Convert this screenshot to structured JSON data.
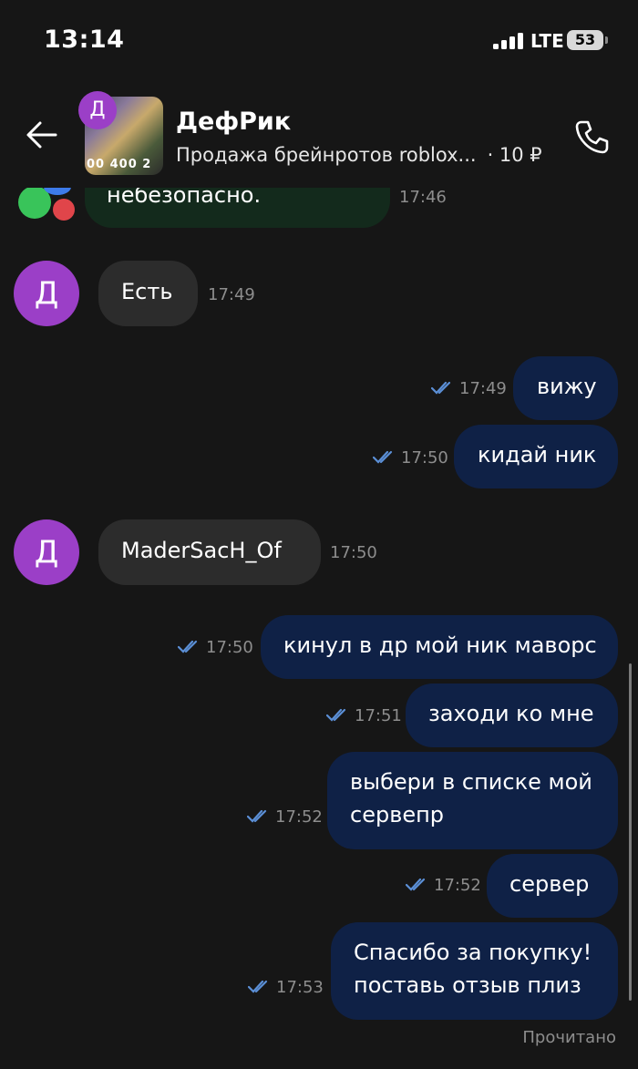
{
  "status_bar": {
    "time": "13:14",
    "network": "LTE",
    "battery": "53"
  },
  "header": {
    "title": "ДефРик",
    "subtitle": "Продажа брейнротов roblox...",
    "price": "· 10 ₽",
    "thumb_text": "00 400 2",
    "thumb_badge": "Д"
  },
  "messages": [
    {
      "id": "m0",
      "dir": "in",
      "text": "небезопасно.",
      "time": "17:46"
    },
    {
      "id": "m1",
      "dir": "in",
      "text": "Есть",
      "time": "17:49",
      "avatar": "Д"
    },
    {
      "id": "m2",
      "dir": "out",
      "text": "вижу",
      "time": "17:49"
    },
    {
      "id": "m3",
      "dir": "out",
      "text": "кидай ник",
      "time": "17:50"
    },
    {
      "id": "m4",
      "dir": "in",
      "text": "MaderSacH_Of",
      "time": "17:50",
      "avatar": "Д"
    },
    {
      "id": "m5",
      "dir": "out",
      "text": "кинул в др мой ник маворс",
      "time": "17:50"
    },
    {
      "id": "m6",
      "dir": "out",
      "text": "заходи ко мне",
      "time": "17:51"
    },
    {
      "id": "m7",
      "dir": "out",
      "line1": "выбери в списке мой",
      "line2": "сервепр",
      "time": "17:52"
    },
    {
      "id": "m8",
      "dir": "out",
      "text": "сервер",
      "time": "17:52"
    },
    {
      "id": "m9",
      "dir": "out",
      "line1": "Спасибо за покупку!",
      "line2": "поставь отзыв плиз",
      "time": "17:53"
    }
  ],
  "read_label": "Прочитано",
  "colors": {
    "background": "#161616",
    "incoming_bubble": "#2c2c2c",
    "outgoing_bubble": "#0f2146",
    "avatar": "#9b3fc7",
    "read_ticks": "#5b8fd6"
  }
}
